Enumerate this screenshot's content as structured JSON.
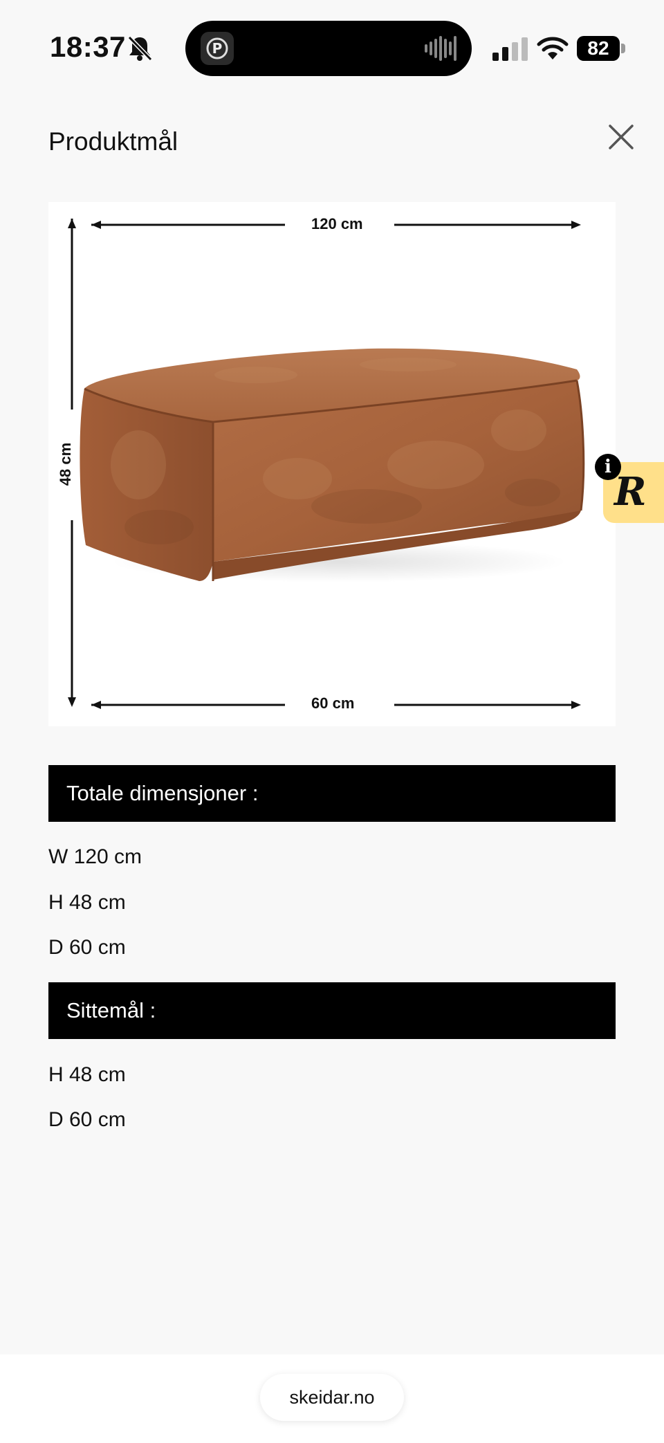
{
  "status_bar": {
    "time": "18:37",
    "battery": "82",
    "icons": [
      "bell-slash-icon",
      "signal-icon",
      "wifi-icon",
      "battery-icon",
      "waveform-icon"
    ]
  },
  "modal": {
    "title": "Produktmål",
    "close_icon": "close-icon"
  },
  "image": {
    "width_label": "120 cm",
    "height_label": "48 cm",
    "depth_label": "60 cm"
  },
  "widget": {
    "letter": "R",
    "info": "i",
    "color": "#ffe08a"
  },
  "sections": [
    {
      "title": "Totale dimensjoner :",
      "items": [
        "W 120 cm",
        "H 48 cm",
        "D 60 cm"
      ]
    },
    {
      "title": "Sittemål :",
      "items": [
        "H 48 cm",
        "D 60 cm"
      ]
    }
  ],
  "browser": {
    "url": "skeidar.no"
  },
  "colors": {
    "background": "#f8f8f8",
    "section_bar": "#000000",
    "leather": "#a4603c"
  }
}
